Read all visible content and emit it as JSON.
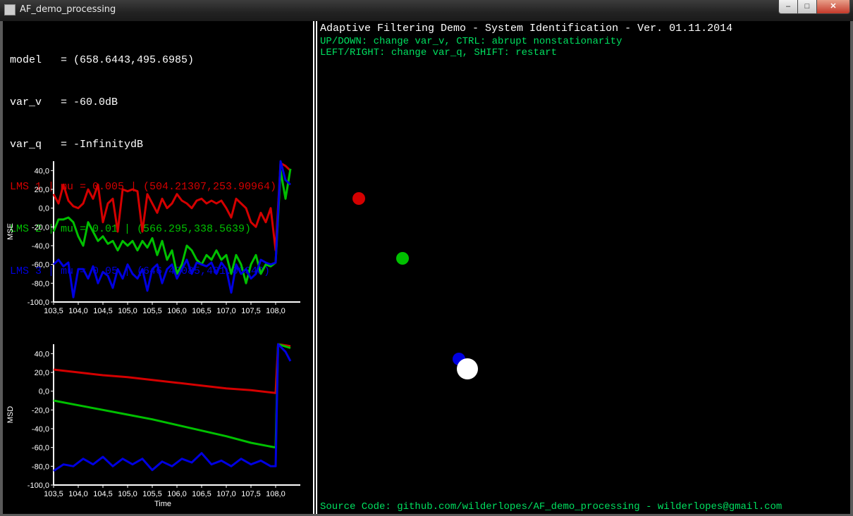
{
  "window": {
    "title": "AF_demo_processing",
    "min": "–",
    "max": "□",
    "close": "✕"
  },
  "left_panel": {
    "model_line": "model   = (658.6443,495.6985)",
    "var_v_line": "var_v   = -60.0dB",
    "var_q_line": "var_q   = -InfinitydB",
    "lms1_line": "LMS 1 | mu = 0.005 | (504.21307,253.90964)",
    "lms2_line": "LMS 2 | mu = 0.01 | (566.295,338.5639)",
    "lms3_line": "LMS 3 | mu = 0.05 | (646.43085,481.06348)"
  },
  "right_panel": {
    "title": "Adaptive Filtering Demo - System Identification - Ver. 01.11.2014",
    "help1": "UP/DOWN: change var_v, CTRL: abrupt nonstationarity",
    "help2": "LEFT/RIGHT: change var_q, SHIFT: restart",
    "footer": "Source Code: github.com/wilderlopes/AF_demo_processing - wilderlopes@gmail.com"
  },
  "colors": {
    "lms1": "#d40000",
    "lms2": "#00c000",
    "lms3": "#0000e0",
    "model": "#ffffff",
    "green_text": "#00e060"
  },
  "scatter": {
    "points": [
      {
        "name": "lms1-dot",
        "color": "#d40000"
      },
      {
        "name": "lms2-dot",
        "color": "#00c000"
      },
      {
        "name": "lms3-dot",
        "color": "#0000e0"
      },
      {
        "name": "model-dot",
        "color": "#ffffff"
      }
    ]
  },
  "chart_data": [
    {
      "type": "line",
      "ylabel": "MSE",
      "xlabel": "",
      "xlim": [
        103.5,
        108.5
      ],
      "ylim": [
        -100,
        50
      ],
      "xticks": [
        "103,5",
        "104,0",
        "104,5",
        "105,0",
        "105,5",
        "106,0",
        "106,5",
        "107,0",
        "107,5",
        "108,0"
      ],
      "yticks": [
        "40,0",
        "20,0",
        "0,0",
        "-20,0",
        "-40,0",
        "-60,0",
        "-80,0",
        "-100,0"
      ],
      "series": [
        {
          "color": "#d40000",
          "x": [
            103.5,
            103.6,
            103.7,
            103.8,
            103.9,
            104.0,
            104.1,
            104.2,
            104.3,
            104.4,
            104.5,
            104.6,
            104.7,
            104.8,
            104.9,
            105.0,
            105.1,
            105.2,
            105.3,
            105.4,
            105.5,
            105.6,
            105.7,
            105.8,
            105.9,
            106.0,
            106.1,
            106.2,
            106.3,
            106.4,
            106.5,
            106.6,
            106.7,
            106.8,
            106.9,
            107.0,
            107.1,
            107.2,
            107.3,
            107.4,
            107.5,
            107.6,
            107.7,
            107.8,
            107.9,
            108.0,
            108.1,
            108.2,
            108.3
          ],
          "y": [
            15,
            5,
            25,
            8,
            2,
            0,
            5,
            20,
            10,
            25,
            -15,
            5,
            10,
            -25,
            20,
            18,
            20,
            18,
            -25,
            15,
            5,
            -5,
            10,
            0,
            5,
            15,
            8,
            5,
            0,
            8,
            10,
            5,
            8,
            5,
            8,
            0,
            -10,
            10,
            5,
            0,
            -15,
            -20,
            -5,
            -15,
            0,
            -45,
            48,
            45,
            40
          ]
        },
        {
          "color": "#00c000",
          "x": [
            103.5,
            103.6,
            103.7,
            103.8,
            103.9,
            104.0,
            104.1,
            104.2,
            104.3,
            104.4,
            104.5,
            104.6,
            104.7,
            104.8,
            104.9,
            105.0,
            105.1,
            105.2,
            105.3,
            105.4,
            105.5,
            105.6,
            105.7,
            105.8,
            105.9,
            106.0,
            106.1,
            106.2,
            106.3,
            106.4,
            106.5,
            106.6,
            106.7,
            106.8,
            106.9,
            107.0,
            107.1,
            107.2,
            107.3,
            107.4,
            107.5,
            107.6,
            107.7,
            107.8,
            107.9,
            108.0,
            108.1,
            108.2,
            108.3
          ],
          "y": [
            -25,
            -12,
            -12,
            -10,
            -15,
            -30,
            -40,
            -15,
            -25,
            -35,
            -30,
            -38,
            -35,
            -45,
            -35,
            -40,
            -35,
            -45,
            -35,
            -42,
            -32,
            -50,
            -35,
            -55,
            -45,
            -70,
            -60,
            -40,
            -45,
            -55,
            -60,
            -50,
            -55,
            -45,
            -55,
            -50,
            -70,
            -50,
            -60,
            -80,
            -60,
            -50,
            -70,
            -60,
            -62,
            -58,
            40,
            10,
            42
          ]
        },
        {
          "color": "#0000e0",
          "x": [
            103.5,
            103.6,
            103.7,
            103.8,
            103.9,
            104.0,
            104.1,
            104.2,
            104.3,
            104.4,
            104.5,
            104.6,
            104.7,
            104.8,
            104.9,
            105.0,
            105.1,
            105.2,
            105.3,
            105.4,
            105.5,
            105.6,
            105.7,
            105.8,
            105.9,
            106.0,
            106.1,
            106.2,
            106.3,
            106.4,
            106.5,
            106.6,
            106.7,
            106.8,
            106.9,
            107.0,
            107.1,
            107.2,
            107.3,
            107.4,
            107.5,
            107.6,
            107.7,
            107.8,
            107.9,
            108.0,
            108.1,
            108.2,
            108.3
          ],
          "y": [
            -60,
            -55,
            -62,
            -58,
            -95,
            -65,
            -65,
            -75,
            -62,
            -80,
            -68,
            -72,
            -85,
            -65,
            -75,
            -60,
            -70,
            -75,
            -65,
            -88,
            -65,
            -60,
            -80,
            -65,
            -60,
            -75,
            -65,
            -55,
            -70,
            -58,
            -60,
            -62,
            -58,
            -70,
            -58,
            -65,
            -90,
            -60,
            -70,
            -65,
            -75,
            -70,
            -55,
            -58,
            -60,
            -58,
            50,
            30,
            25
          ]
        }
      ]
    },
    {
      "type": "line",
      "ylabel": "MSD",
      "xlabel": "Time",
      "xlim": [
        103.5,
        108.5
      ],
      "ylim": [
        -100,
        50
      ],
      "xticks": [
        "103,5",
        "104,0",
        "104,5",
        "105,0",
        "105,5",
        "106,0",
        "106,5",
        "107,0",
        "107,5",
        "108,0"
      ],
      "yticks": [
        "40,0",
        "20,0",
        "0,0",
        "-20,0",
        "-40,0",
        "-60,0",
        "-80,0",
        "-100,0"
      ],
      "series": [
        {
          "color": "#d40000",
          "x": [
            103.5,
            104.0,
            104.5,
            105.0,
            105.5,
            106.0,
            106.5,
            107.0,
            107.5,
            108.0,
            108.05,
            108.3
          ],
          "y": [
            23,
            20,
            17,
            15,
            12,
            9,
            6,
            3,
            1,
            -2,
            50,
            48
          ]
        },
        {
          "color": "#00c000",
          "x": [
            103.5,
            104.0,
            104.5,
            105.0,
            105.5,
            106.0,
            106.5,
            107.0,
            107.5,
            108.0,
            108.05,
            108.3
          ],
          "y": [
            -10,
            -15,
            -20,
            -25,
            -30,
            -36,
            -42,
            -48,
            -55,
            -60,
            50,
            46
          ]
        },
        {
          "color": "#0000e0",
          "x": [
            103.5,
            103.7,
            103.9,
            104.1,
            104.3,
            104.5,
            104.7,
            104.9,
            105.1,
            105.3,
            105.5,
            105.7,
            105.9,
            106.1,
            106.3,
            106.5,
            106.7,
            106.9,
            107.1,
            107.3,
            107.5,
            107.7,
            107.9,
            108.0,
            108.05,
            108.2,
            108.3
          ],
          "y": [
            -85,
            -78,
            -80,
            -72,
            -78,
            -70,
            -80,
            -72,
            -78,
            -72,
            -84,
            -75,
            -80,
            -72,
            -76,
            -66,
            -78,
            -74,
            -80,
            -72,
            -78,
            -74,
            -80,
            -80,
            50,
            42,
            32
          ]
        }
      ]
    }
  ]
}
